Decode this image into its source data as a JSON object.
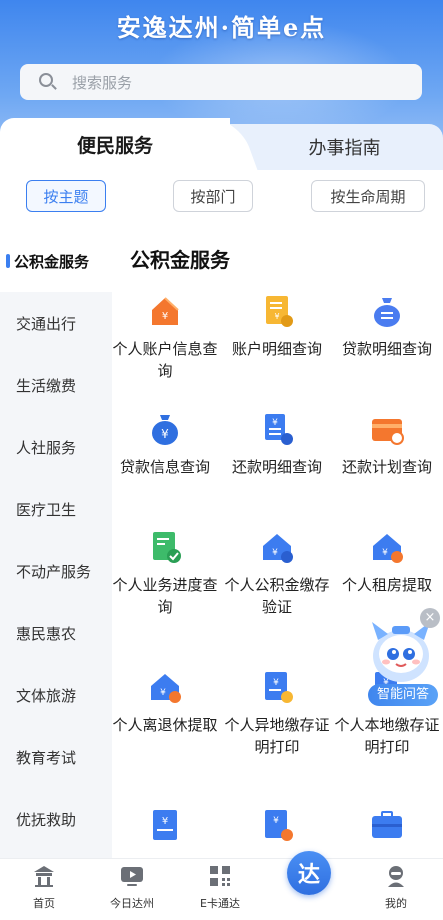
{
  "header": {
    "slogan": "安逸达州·简单e点"
  },
  "search": {
    "placeholder": "搜索服务"
  },
  "tabs": {
    "primary": "便民服务",
    "secondary": "办事指南"
  },
  "filters": [
    "按主题",
    "按部门",
    "按生命周期"
  ],
  "sidebar": {
    "items": [
      "公积金服务",
      "交通出行",
      "生活缴费",
      "人社服务",
      "医疗卫生",
      "不动产服务",
      "惠民惠农",
      "文体旅游",
      "教育考试",
      "优抚救助"
    ]
  },
  "section": {
    "title": "公积金服务"
  },
  "services": [
    {
      "label": "个人账户信息查询",
      "icon": "house-yuan-icon"
    },
    {
      "label": "账户明细查询",
      "icon": "receipt-icon"
    },
    {
      "label": "贷款明细查询",
      "icon": "moneybag-list-icon"
    },
    {
      "label": "贷款信息查询",
      "icon": "moneybag-yuan-icon"
    },
    {
      "label": "还款明细查询",
      "icon": "repay-detail-icon"
    },
    {
      "label": "还款计划查询",
      "icon": "card-plan-icon"
    },
    {
      "label": "个人业务进度查询",
      "icon": "doc-check-icon"
    },
    {
      "label": "个人公积金缴存验证",
      "icon": "house-verify-icon"
    },
    {
      "label": "个人租房提取",
      "icon": "house-rent-icon"
    },
    {
      "label": "个人离退休提取",
      "icon": "house-retire-icon"
    },
    {
      "label": "个人异地缴存证明打印",
      "icon": "doc-print-icon"
    },
    {
      "label": "个人本地缴存证明打印",
      "icon": "doc-print-local-icon"
    },
    {
      "label": "",
      "icon": "doc-yuan-icon"
    },
    {
      "label": "",
      "icon": "doc-seal-icon"
    },
    {
      "label": "",
      "icon": "briefcase-icon"
    }
  ],
  "assistant": {
    "label": "智能问答",
    "close": "×"
  },
  "bottom_nav": {
    "items": [
      "首页",
      "今日达州",
      "E卡通达",
      "",
      "我的"
    ],
    "center": "达"
  }
}
